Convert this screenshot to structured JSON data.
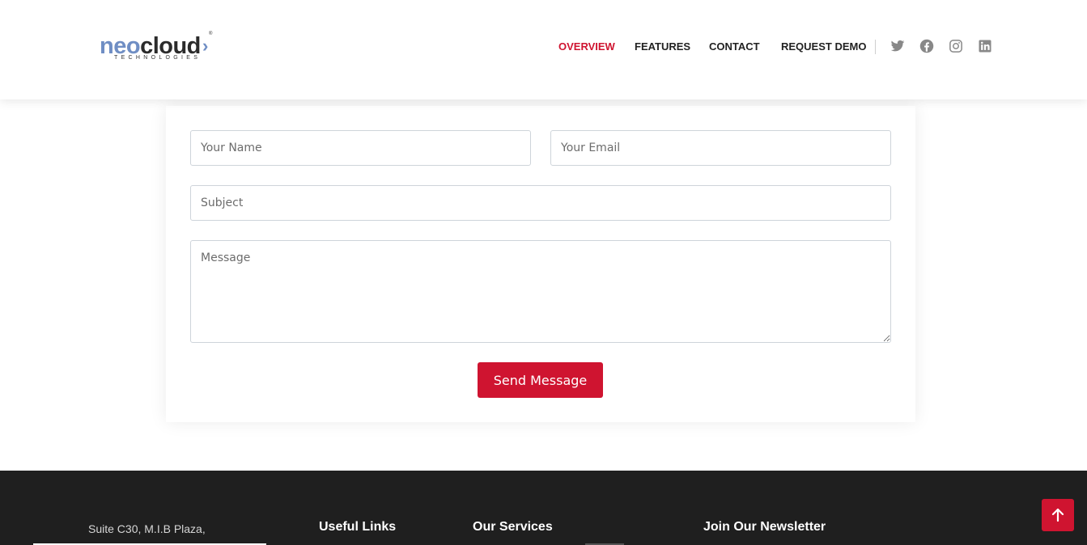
{
  "header": {
    "logo": {
      "primary": "neo",
      "secondary": "cloud",
      "tagline": "TECHNOLOGIES",
      "registered": "®"
    },
    "nav": [
      {
        "label": "OVERVIEW",
        "active": true
      },
      {
        "label": "FEATURES",
        "active": false
      },
      {
        "label": "CONTACT",
        "active": false
      },
      {
        "label": "REQUEST DEMO",
        "active": false
      }
    ],
    "social_icons": [
      "twitter-icon",
      "facebook-icon",
      "instagram-icon",
      "linkedin-icon"
    ]
  },
  "contact_form": {
    "name_placeholder": "Your Name",
    "email_placeholder": "Your Email",
    "subject_placeholder": "Subject",
    "message_placeholder": "Message",
    "submit_label": "Send Message"
  },
  "footer": {
    "address_line1": "Suite C30, M.I.B Plaza,",
    "useful_links_heading": "Useful Links",
    "services_heading": "Our Services",
    "newsletter_heading": "Join Our Newsletter"
  },
  "back_to_top_icon": "arrow-up-icon",
  "colors": {
    "accent": "#cf1430",
    "nav_text": "#222222",
    "social_icon": "#888888",
    "footer_bg": "#1f1f1f",
    "logo_blue": "#6f8ec4"
  }
}
